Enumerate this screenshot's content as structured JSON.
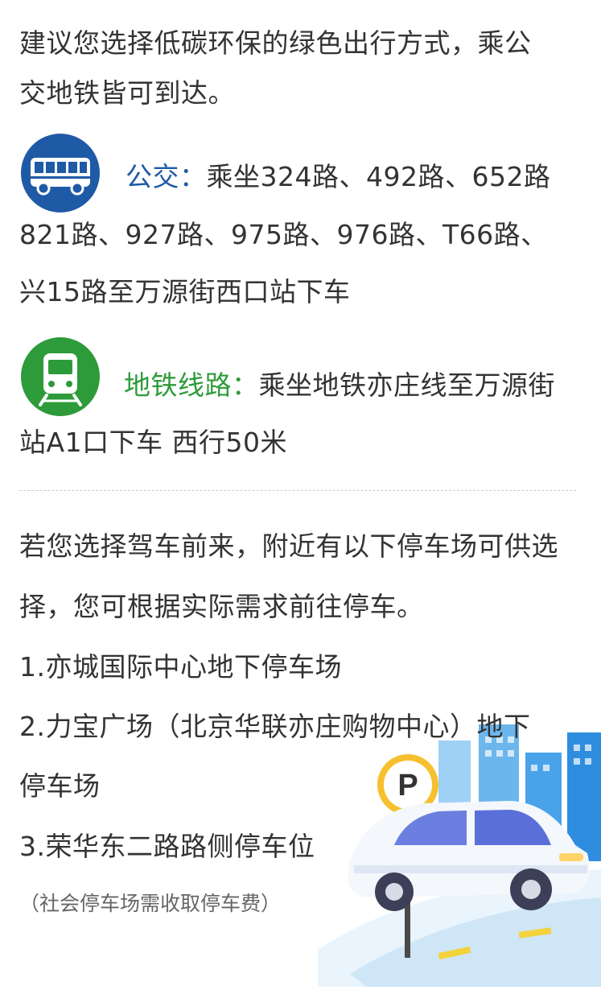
{
  "intro": {
    "line1": "建议您选择低碳环保的绿色出行方式，乘公",
    "line2": "交地铁皆可到达。"
  },
  "bus": {
    "label": "公交：",
    "text1": "乘坐324路、492路、652路",
    "line2": "821路、927路、975路、976路、T66路、",
    "line3": "兴15路至万源街西口站下车",
    "color": "#1f5aa6"
  },
  "subway": {
    "label": "地铁线路：",
    "text1": "乘坐地铁亦庄线至万源街",
    "line2": "站A1口下车 西行50米",
    "color": "#2d9b3a"
  },
  "parking": {
    "intro_line1": "若您选择驾车前来，附近有以下停车场可供选",
    "intro_line2": "择，您可根据实际需求前往停车。",
    "item1": "1.亦城国际中心地下停车场",
    "item2_line1": "2.力宝广场（北京华联亦庄购物中心）地下",
    "item2_line2": "停车场",
    "item3": "3.荣华东二路路侧停车位",
    "note": "（社会停车场需收取停车费）",
    "sign_letter": "P"
  }
}
